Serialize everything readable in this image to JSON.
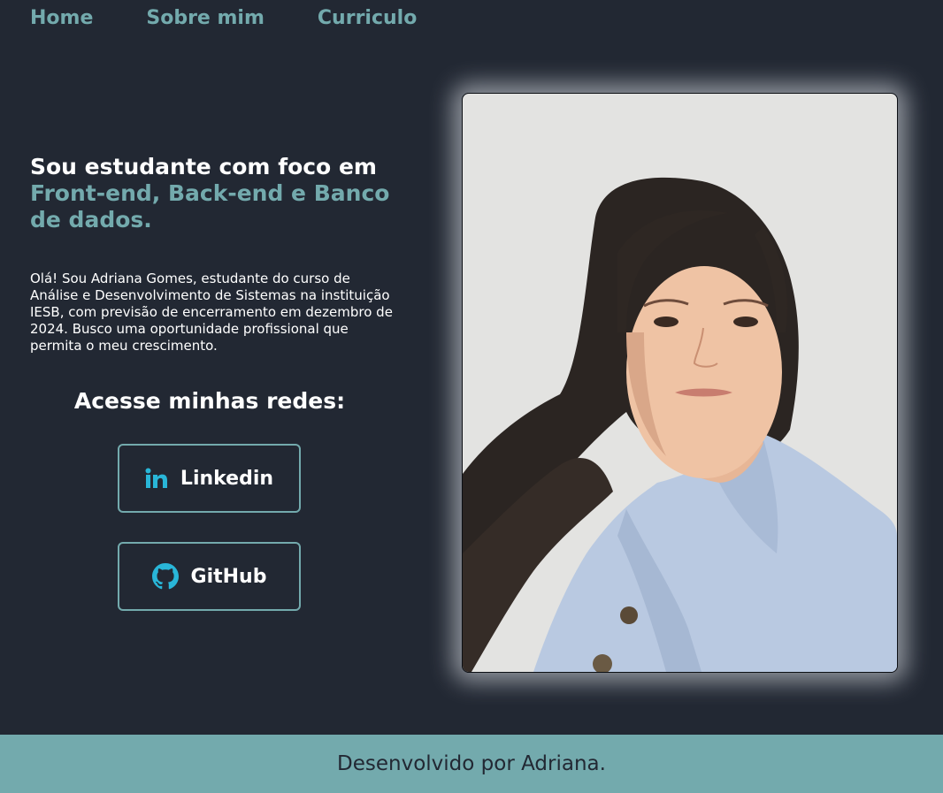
{
  "nav": {
    "items": [
      {
        "label": "Home"
      },
      {
        "label": "Sobre mim"
      },
      {
        "label": "Curriculo"
      }
    ]
  },
  "hero": {
    "headline_plain": "Sou estudante com foco em ",
    "headline_accent": "Front-end, Back-end e Banco de dados.",
    "intro": "Olá! Sou Adriana Gomes, estudante do curso de Análise e Desenvolvimento de Sistemas na instituição IESB, com previsão de encerramento em dezembro de 2024. Busco uma oportunidade profissional que permita o meu crescimento.",
    "networks_title": "Acesse minhas redes:",
    "links": {
      "linkedin": {
        "label": "Linkedin",
        "icon": "linkedin-icon"
      },
      "github": {
        "label": "GitHub",
        "icon": "github-icon"
      }
    }
  },
  "footer": {
    "text": "Desenvolvido por Adriana."
  },
  "colors": {
    "background": "#222833",
    "accent": "#73aaad",
    "icon": "#29b6d8",
    "text": "#ffffff"
  }
}
